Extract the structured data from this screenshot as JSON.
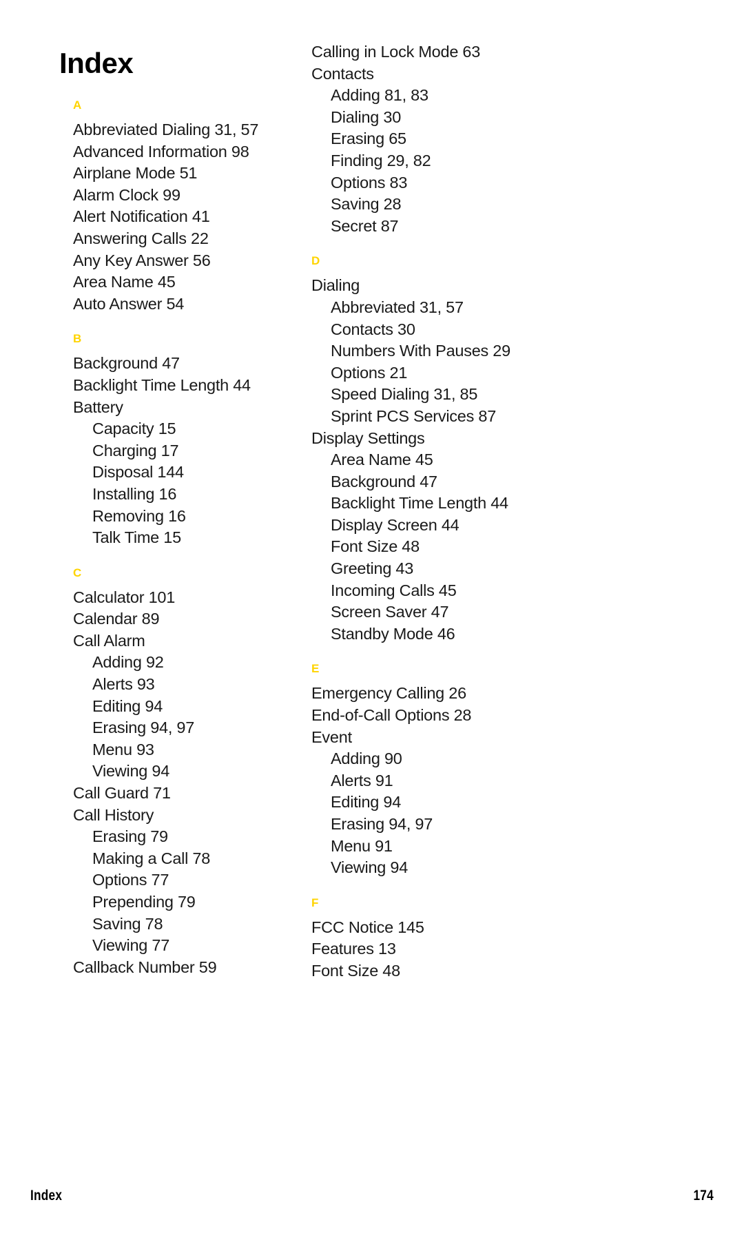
{
  "page": {
    "title": "Index",
    "accent_color": "#FFD400",
    "text_color": "#1a1a1a",
    "background_color": "#ffffff"
  },
  "footer": {
    "label": "Index",
    "page_number": "174"
  },
  "columns": [
    {
      "name": "left-column",
      "sections": [
        {
          "letter": "A",
          "entries": [
            {
              "level": 0,
              "text": "Abbreviated Dialing 31, 57"
            },
            {
              "level": 0,
              "text": "Advanced Information 98"
            },
            {
              "level": 0,
              "text": "Airplane Mode 51"
            },
            {
              "level": 0,
              "text": "Alarm Clock 99"
            },
            {
              "level": 0,
              "text": "Alert Notification 41"
            },
            {
              "level": 0,
              "text": "Answering Calls 22"
            },
            {
              "level": 0,
              "text": "Any Key Answer 56"
            },
            {
              "level": 0,
              "text": "Area Name 45"
            },
            {
              "level": 0,
              "text": "Auto Answer 54"
            }
          ]
        },
        {
          "letter": "B",
          "entries": [
            {
              "level": 0,
              "text": "Background 47"
            },
            {
              "level": 0,
              "text": "Backlight Time Length 44"
            },
            {
              "level": 0,
              "text": "Battery"
            },
            {
              "level": 1,
              "text": "Capacity 15"
            },
            {
              "level": 1,
              "text": "Charging 17"
            },
            {
              "level": 1,
              "text": "Disposal 144"
            },
            {
              "level": 1,
              "text": "Installing 16"
            },
            {
              "level": 1,
              "text": "Removing 16"
            },
            {
              "level": 1,
              "text": "Talk Time 15"
            }
          ]
        },
        {
          "letter": "C",
          "entries": [
            {
              "level": 0,
              "text": "Calculator 101"
            },
            {
              "level": 0,
              "text": "Calendar 89"
            },
            {
              "level": 0,
              "text": "Call Alarm"
            },
            {
              "level": 1,
              "text": "Adding 92"
            },
            {
              "level": 1,
              "text": "Alerts 93"
            },
            {
              "level": 1,
              "text": "Editing 94"
            },
            {
              "level": 1,
              "text": "Erasing 94, 97"
            },
            {
              "level": 1,
              "text": "Menu 93"
            },
            {
              "level": 1,
              "text": "Viewing 94"
            },
            {
              "level": 0,
              "text": "Call Guard 71"
            },
            {
              "level": 0,
              "text": "Call History"
            },
            {
              "level": 1,
              "text": "Erasing 79"
            },
            {
              "level": 1,
              "text": "Making a Call 78"
            },
            {
              "level": 1,
              "text": "Options 77"
            },
            {
              "level": 1,
              "text": "Prepending 79"
            },
            {
              "level": 1,
              "text": "Saving 78"
            },
            {
              "level": 1,
              "text": "Viewing 77"
            },
            {
              "level": 0,
              "text": "Callback Number 59"
            }
          ]
        }
      ]
    },
    {
      "name": "right-column",
      "sections": [
        {
          "letter": "",
          "entries": [
            {
              "level": 0,
              "text": "Calling in Lock Mode 63"
            },
            {
              "level": 0,
              "text": "Contacts"
            },
            {
              "level": 1,
              "text": "Adding 81, 83"
            },
            {
              "level": 1,
              "text": "Dialing 30"
            },
            {
              "level": 1,
              "text": "Erasing 65"
            },
            {
              "level": 1,
              "text": "Finding 29, 82"
            },
            {
              "level": 1,
              "text": "Options 83"
            },
            {
              "level": 1,
              "text": "Saving 28"
            },
            {
              "level": 1,
              "text": "Secret 87"
            }
          ]
        },
        {
          "letter": "D",
          "entries": [
            {
              "level": 0,
              "text": "Dialing"
            },
            {
              "level": 1,
              "text": "Abbreviated 31, 57"
            },
            {
              "level": 1,
              "text": "Contacts 30"
            },
            {
              "level": 1,
              "text": "Numbers With Pauses 29"
            },
            {
              "level": 1,
              "text": "Options 21"
            },
            {
              "level": 1,
              "text": "Speed Dialing 31, 85"
            },
            {
              "level": 1,
              "text": "Sprint PCS Services 87"
            },
            {
              "level": 0,
              "text": "Display Settings"
            },
            {
              "level": 1,
              "text": "Area Name 45"
            },
            {
              "level": 1,
              "text": "Background 47"
            },
            {
              "level": 1,
              "text": "Backlight Time Length 44"
            },
            {
              "level": 1,
              "text": "Display Screen 44"
            },
            {
              "level": 1,
              "text": "Font Size 48"
            },
            {
              "level": 1,
              "text": "Greeting 43"
            },
            {
              "level": 1,
              "text": "Incoming Calls 45"
            },
            {
              "level": 1,
              "text": "Screen Saver 47"
            },
            {
              "level": 1,
              "text": "Standby Mode 46"
            }
          ]
        },
        {
          "letter": "E",
          "entries": [
            {
              "level": 0,
              "text": "Emergency Calling 26"
            },
            {
              "level": 0,
              "text": "End-of-Call Options 28"
            },
            {
              "level": 0,
              "text": "Event"
            },
            {
              "level": 1,
              "text": "Adding 90"
            },
            {
              "level": 1,
              "text": "Alerts 91"
            },
            {
              "level": 1,
              "text": "Editing 94"
            },
            {
              "level": 1,
              "text": "Erasing 94, 97"
            },
            {
              "level": 1,
              "text": "Menu 91"
            },
            {
              "level": 1,
              "text": "Viewing 94"
            }
          ]
        },
        {
          "letter": "F",
          "entries": [
            {
              "level": 0,
              "text": "FCC Notice 145"
            },
            {
              "level": 0,
              "text": "Features 13"
            },
            {
              "level": 0,
              "text": "Font Size 48"
            }
          ]
        }
      ]
    }
  ]
}
